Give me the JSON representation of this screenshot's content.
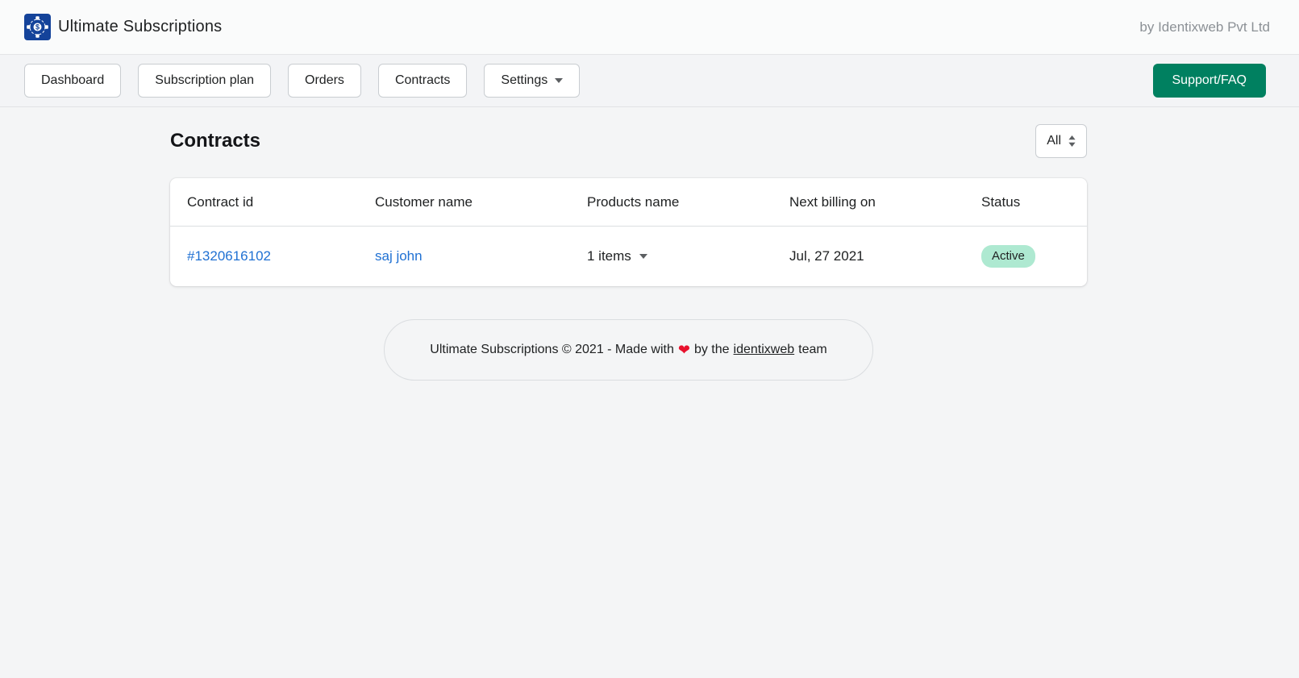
{
  "app": {
    "title": "Ultimate Subscriptions",
    "byline": "by Identixweb Pvt Ltd"
  },
  "nav": {
    "items": [
      {
        "label": "Dashboard"
      },
      {
        "label": "Subscription plan"
      },
      {
        "label": "Orders"
      },
      {
        "label": "Contracts"
      },
      {
        "label": "Settings"
      }
    ],
    "support_label": "Support/FAQ"
  },
  "page": {
    "title": "Contracts",
    "filter_value": "All"
  },
  "table": {
    "headers": [
      "Contract id",
      "Customer name",
      "Products name",
      "Next billing on",
      "Status"
    ],
    "rows": [
      {
        "contract_id": "#1320616102",
        "customer_name": "saj john",
        "products_label": "1 items",
        "next_billing_on": "Jul, 27 2021",
        "status": "Active"
      }
    ]
  },
  "footer": {
    "text_before": "Ultimate Subscriptions © 2021 - Made with",
    "heart": "❤",
    "text_middle": "by the",
    "link_text": "identixweb",
    "text_after": "team"
  },
  "colors": {
    "accent_green": "#008060",
    "link_blue": "#2071d3",
    "badge_bg": "#aee9d1",
    "logo_blue": "#14439a",
    "heart_red": "#e8112d"
  }
}
